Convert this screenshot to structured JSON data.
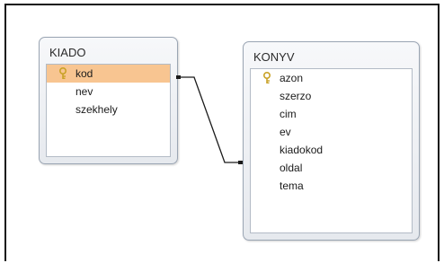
{
  "tables": [
    {
      "name": "KIADO",
      "fields": [
        {
          "label": "kod",
          "key": true,
          "selected": true
        },
        {
          "label": "nev",
          "key": false,
          "selected": false
        },
        {
          "label": "szekhely",
          "key": false,
          "selected": false
        }
      ]
    },
    {
      "name": "KONYV",
      "fields": [
        {
          "label": "azon",
          "key": true,
          "selected": false
        },
        {
          "label": "szerzo",
          "key": false,
          "selected": false
        },
        {
          "label": "cim",
          "key": false,
          "selected": false
        },
        {
          "label": "ev",
          "key": false,
          "selected": false
        },
        {
          "label": "kiadokod",
          "key": false,
          "selected": false
        },
        {
          "label": "oldal",
          "key": false,
          "selected": false
        },
        {
          "label": "tema",
          "key": false,
          "selected": false
        }
      ]
    }
  ],
  "relationship": {
    "from": "KIADO.kod",
    "to": "KONYV.kiadokod"
  },
  "colors": {
    "selected_row": "#f8c591",
    "key_icon": "#c9a227",
    "connector": "#1a1a1a"
  }
}
